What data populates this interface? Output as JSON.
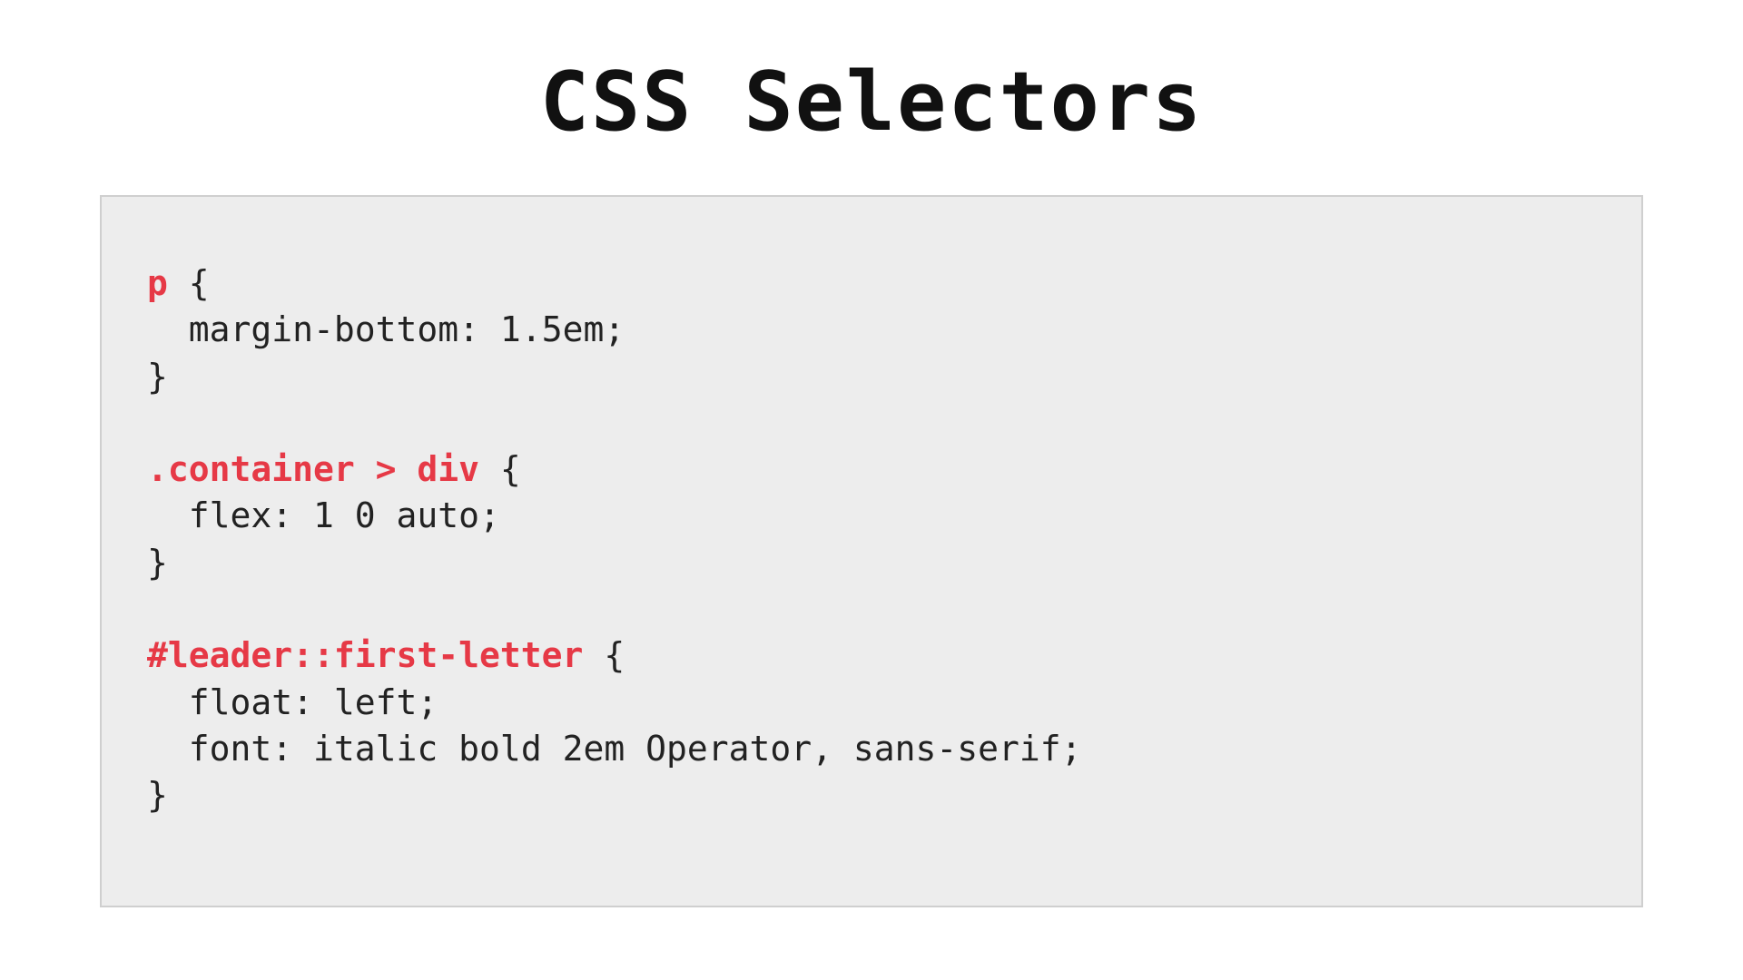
{
  "title": "CSS Selectors",
  "colors": {
    "selector": "#e63946",
    "text": "#222222",
    "box_bg": "#ededed",
    "box_border": "#cfcfcf"
  },
  "code": {
    "rules": [
      {
        "selector": "p",
        "declarations": [
          "margin-bottom: 1.5em;"
        ]
      },
      {
        "selector": ".container > div",
        "declarations": [
          "flex: 1 0 auto;"
        ]
      },
      {
        "selector": "#leader::first-letter",
        "declarations": [
          "float: left;",
          "font: italic bold 2em Operator, sans-serif;"
        ]
      }
    ]
  },
  "brace_open": "{",
  "brace_close": "}",
  "indent": "  "
}
